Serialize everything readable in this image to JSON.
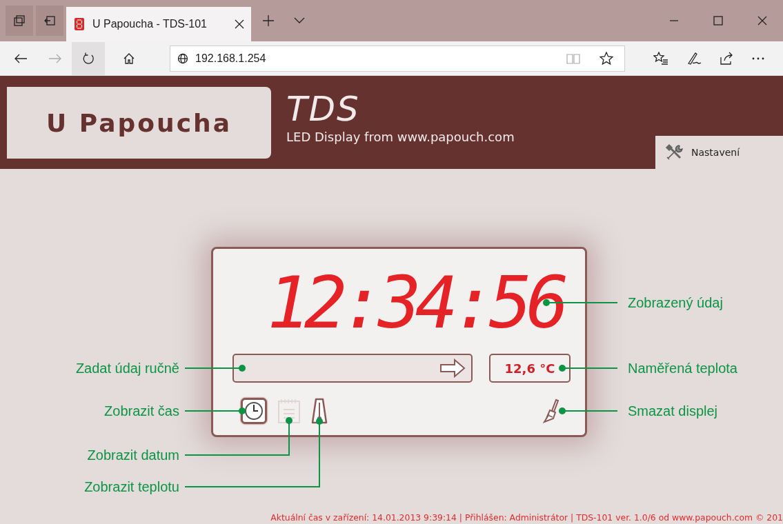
{
  "browser": {
    "tabs": [
      {
        "title": "U Papoucha - TDS-101",
        "selected": true
      }
    ],
    "address": "192.168.1.254"
  },
  "header": {
    "logo": "U Papoucha",
    "product": "TDS",
    "subtitle": "LED Display from www.papouch.com",
    "settings_link": "Nastavení"
  },
  "display": {
    "value": "12:34:56",
    "value_callout": "Zobrazený údaj",
    "input_callout": "Zadat údaj ručně",
    "temperature": "12,6 °C",
    "temperature_callout": "Naměřená teplota",
    "clear_callout": "Smazat displej",
    "modes": [
      {
        "kind": "clock",
        "selected": true,
        "disabled": false
      },
      {
        "kind": "calendar",
        "selected": false,
        "disabled": true
      },
      {
        "kind": "thermometer",
        "selected": false,
        "disabled": false
      }
    ],
    "mode_callouts": [
      "Zobrazit čas",
      "Zobrazit datum",
      "Zobrazit teplotu"
    ]
  },
  "status_bar": "Aktuální čas v zařízení: 14.01.2013 9:39:14 | Přihlášen: Administrátor | TDS-101 ver. 1.0/6 od www.papouch.com © 201"
}
